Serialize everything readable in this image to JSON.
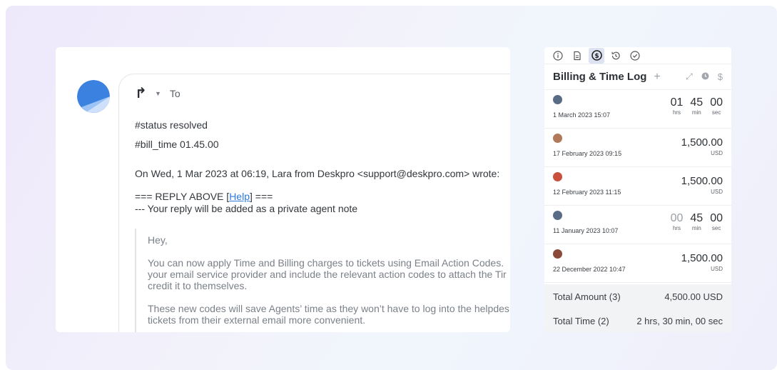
{
  "email": {
    "reply_to_label": "To",
    "lines": [
      "#status resolved",
      "#bill_time 01.45.00",
      "On Wed, 1 Mar 2023 at 06:19, Lara from Deskpro <support@deskpro.com> wrote:"
    ],
    "reply_above_prefix": "=== REPLY ABOVE [",
    "help_link": "Help",
    "reply_above_suffix": "] ===",
    "private_note": "--- Your reply will be added as a private agent note",
    "quote": [
      "Hey,",
      "You can now apply Time and Billing charges to tickets using Email Action Codes.",
      "your email service provider and include the relevant action codes to attach the Tir",
      "credit it to themselves.",
      "These new codes will save Agents’ time as they won’t have to log into the helpdes",
      "tickets from their external email more convenient."
    ]
  },
  "panel": {
    "tabs": [
      "info-icon",
      "document-icon",
      "billing-icon",
      "history-icon",
      "check-icon"
    ],
    "active_tab": "billing-icon",
    "title": "Billing & Time Log",
    "entries": [
      {
        "kind": "time",
        "date": "1 March 2023 15:07",
        "hrs": "01",
        "min": "45",
        "sec": "00",
        "hrs_label": "hrs",
        "min_label": "min",
        "sec_label": "sec",
        "avatar_color": "#5a6b86"
      },
      {
        "kind": "amount",
        "date": "17 February 2023 09:15",
        "amount": "1,500.00",
        "currency": "USD",
        "avatar_color": "#b07a5a"
      },
      {
        "kind": "amount",
        "date": "12 February 2023 11:15",
        "amount": "1,500.00",
        "currency": "USD",
        "avatar_color": "#c8503c"
      },
      {
        "kind": "time",
        "date": "11 January 2023 10:07",
        "hrs": "00",
        "min": "45",
        "sec": "00",
        "hrs_label": "hrs",
        "min_label": "min",
        "sec_label": "sec",
        "avatar_color": "#5a6b86"
      },
      {
        "kind": "amount",
        "date": "22 December 2022 10:47",
        "amount": "1,500.00",
        "currency": "USD",
        "avatar_color": "#8a4a38"
      }
    ],
    "total_amount_label": "Total Amount (3)",
    "total_amount_value": "4,500.00 USD",
    "total_time_label": "Total Time (2)",
    "total_time_value": "2 hrs, 30 min, 00 sec"
  }
}
